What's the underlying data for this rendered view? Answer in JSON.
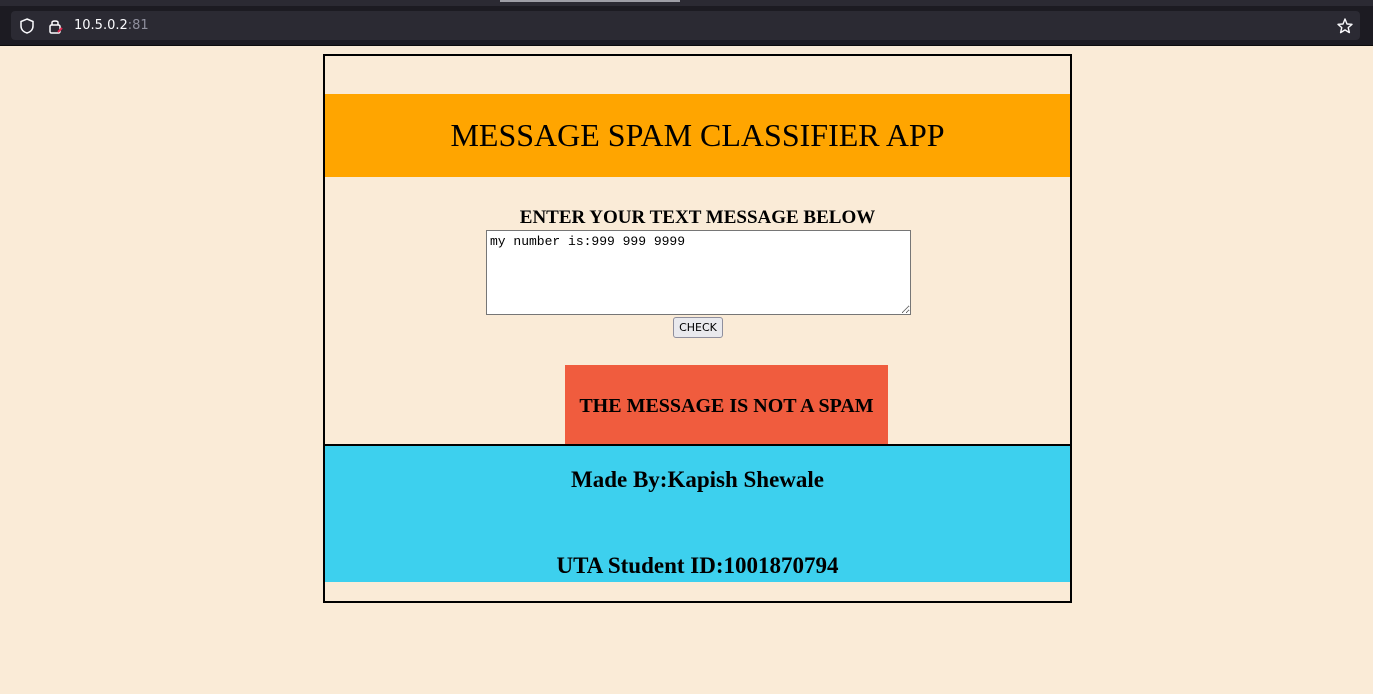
{
  "browser": {
    "url_host": "10.5.0.2",
    "url_port": ":81",
    "icons": [
      "shield-icon",
      "lock-icon",
      "star-icon"
    ]
  },
  "app": {
    "title": "MESSAGE SPAM CLASSIFIER APP",
    "form_label": "ENTER YOUR TEXT MESSAGE BELOW",
    "message_value": "my number is:999 999 9999",
    "check_label": "CHECK",
    "result": "THE MESSAGE IS NOT A SPAM",
    "author": "Made By:Kapish Shewale",
    "student_id": "UTA Student ID:1001870794"
  },
  "colors": {
    "page_bg": "#faebd7",
    "header_bg": "#ffa500",
    "result_bg": "#f05c3e",
    "footer_bg": "#3dd0ee"
  }
}
